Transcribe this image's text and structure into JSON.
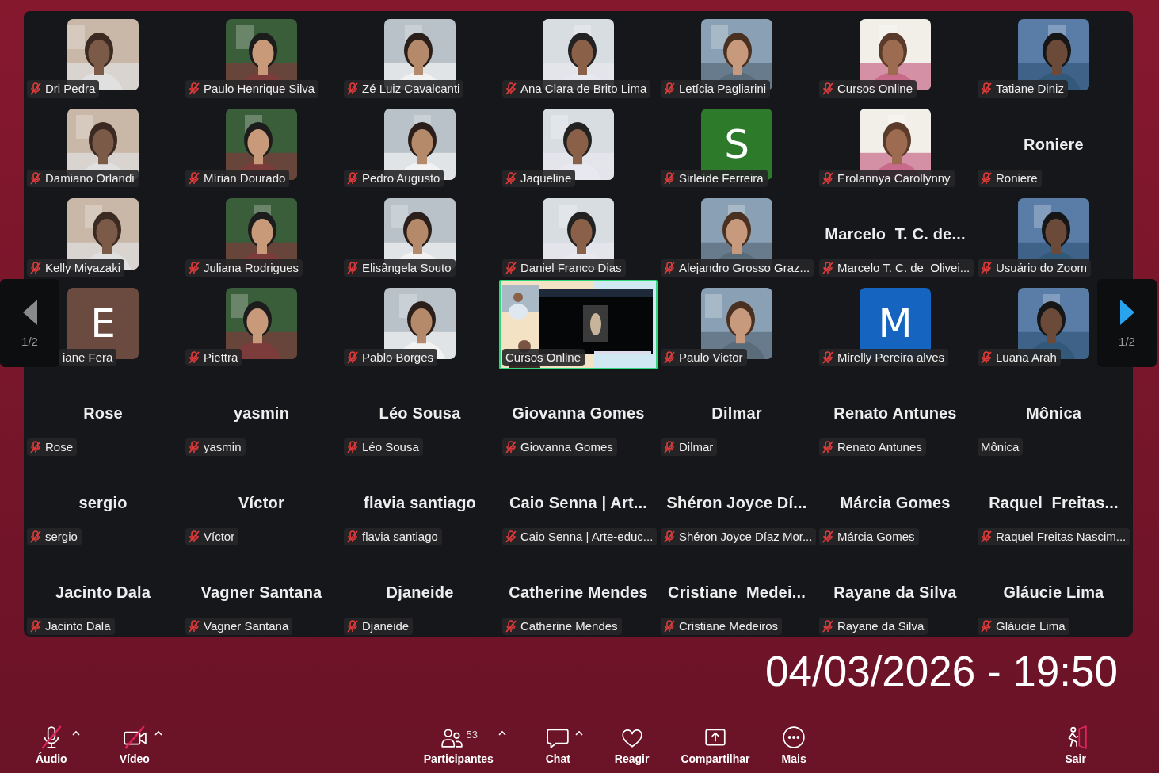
{
  "gallery": {
    "tiles": [
      {
        "label": "Dri Pedra",
        "muted": true,
        "active": false
      },
      {
        "label": "Paulo Henrique Silva",
        "muted": true,
        "active": false
      },
      {
        "label": "Zé Luiz Cavalcanti",
        "muted": true,
        "active": false
      },
      {
        "label": "Ana Clara de Brito Lima",
        "muted": true,
        "active": false
      },
      {
        "label": "Letícia Pagliarini",
        "muted": true,
        "active": false
      },
      {
        "label": "Cursos Online",
        "muted": true,
        "active": false
      },
      {
        "label": "Tatiane Diniz",
        "muted": true,
        "active": false
      },
      {
        "label": "Damiano Orlandi",
        "muted": true,
        "active": false
      },
      {
        "label": "Mírian Dourado",
        "muted": true,
        "active": false
      },
      {
        "label": "Pedro Augusto",
        "muted": true,
        "active": false
      },
      {
        "label": "Jaqueline",
        "muted": true,
        "active": false
      },
      {
        "kind": "letter",
        "letter": "S",
        "color": "#2e7a2b",
        "label": "Sirleide Ferreira",
        "muted": true,
        "active": false
      },
      {
        "label": "Erolannya Carollynny",
        "muted": true,
        "active": false
      },
      {
        "kind": "name",
        "display_name": "Roniere",
        "label": "Roniere",
        "muted": true,
        "active": false
      },
      {
        "label": "Kelly Miyazaki",
        "muted": true,
        "active": false
      },
      {
        "label": "Juliana Rodrigues",
        "muted": true,
        "active": false
      },
      {
        "label": "Elisângela Souto",
        "muted": true,
        "active": false
      },
      {
        "label": "Daniel Franco Dias",
        "muted": true,
        "active": false
      },
      {
        "label": "Alejandro Grosso Graz...",
        "muted": true,
        "active": false
      },
      {
        "kind": "name",
        "display_name": "Marcelo  T. C. de...",
        "label": "Marcelo T. C. de  Olivei...",
        "muted": true,
        "active": false
      },
      {
        "label": "Usuário do Zoom",
        "muted": true,
        "active": false
      },
      {
        "kind": "letter",
        "letter": "E",
        "color": "#6b4a40",
        "label": "iane Fera",
        "muted": false,
        "active": false,
        "partly_hidden": true
      },
      {
        "label": "Piettra",
        "muted": true,
        "active": false
      },
      {
        "label": "Pablo Borges",
        "muted": true,
        "active": false
      },
      {
        "kind": "screen",
        "label": "Cursos Online",
        "muted": false,
        "active": true
      },
      {
        "label": "Paulo Victor",
        "muted": true,
        "active": false
      },
      {
        "kind": "letter",
        "letter": "M",
        "color": "#1565c0",
        "label": "Mirelly Pereira alves",
        "muted": true,
        "active": false
      },
      {
        "label": "Luana Arah",
        "muted": true,
        "active": false
      },
      {
        "kind": "name",
        "display_name": "Rose",
        "label": "Rose",
        "muted": true,
        "active": false
      },
      {
        "kind": "name",
        "display_name": "yasmin",
        "label": "yasmin",
        "muted": true,
        "active": false
      },
      {
        "kind": "name",
        "display_name": "Léo Sousa",
        "label": "Léo Sousa",
        "muted": true,
        "active": false
      },
      {
        "kind": "name",
        "display_name": "Giovanna Gomes",
        "label": "Giovanna Gomes",
        "muted": true,
        "active": false
      },
      {
        "kind": "name",
        "display_name": "Dilmar",
        "label": "Dilmar",
        "muted": true,
        "active": false
      },
      {
        "kind": "name",
        "display_name": "Renato Antunes",
        "label": "Renato Antunes",
        "muted": true,
        "active": false
      },
      {
        "kind": "name",
        "display_name": "Mônica",
        "label": "Mônica",
        "muted": false,
        "active": false
      },
      {
        "kind": "name",
        "display_name": "sergio",
        "label": "sergio",
        "muted": true,
        "active": false
      },
      {
        "kind": "name",
        "display_name": "Víctor",
        "label": "Víctor",
        "muted": true,
        "active": false
      },
      {
        "kind": "name",
        "display_name": "flavia santiago",
        "label": "flavia santiago",
        "muted": true,
        "active": false
      },
      {
        "kind": "name",
        "display_name": "Caio Senna | Art...",
        "label": "Caio Senna | Arte-educ...",
        "muted": true,
        "active": false
      },
      {
        "kind": "name",
        "display_name": "Shéron Joyce Dí...",
        "label": "Shéron Joyce Díaz Mor...",
        "muted": true,
        "active": false
      },
      {
        "kind": "name",
        "display_name": "Márcia Gomes",
        "label": "Márcia Gomes",
        "muted": true,
        "active": false
      },
      {
        "kind": "name",
        "display_name": "Raquel  Freitas...",
        "label": "Raquel Freitas Nascim...",
        "muted": true,
        "active": false
      },
      {
        "kind": "name",
        "display_name": "Jacinto Dala",
        "label": "Jacinto Dala",
        "muted": true,
        "active": false
      },
      {
        "kind": "name",
        "display_name": "Vagner Santana",
        "label": "Vagner Santana",
        "muted": true,
        "active": false
      },
      {
        "kind": "name",
        "display_name": "Djaneide",
        "label": "Djaneide",
        "muted": true,
        "active": false
      },
      {
        "kind": "name",
        "display_name": "Catherine Mendes",
        "label": "Catherine Mendes",
        "muted": true,
        "active": false
      },
      {
        "kind": "name",
        "display_name": "Cristiane  Medei...",
        "label": "Cristiane Medeiros",
        "muted": true,
        "active": false
      },
      {
        "kind": "name",
        "display_name": "Rayane da Silva",
        "label": "Rayane da Silva",
        "muted": true,
        "active": false
      },
      {
        "kind": "name",
        "display_name": "Gláucie Lima",
        "label": "Gláucie Lima",
        "muted": true,
        "active": false
      }
    ],
    "pager": [
      {
        "kind": "prev",
        "page": "1/2",
        "disabled": true
      },
      {
        "kind": "next",
        "page": "1/2",
        "disabled": false
      }
    ]
  },
  "datetime": "04/03/2026 - 19:50",
  "toolbar": [
    {
      "kind": "audio",
      "label": "Áudio",
      "off": true,
      "has_menu": true
    },
    {
      "kind": "video",
      "label": "Vídeo",
      "off": true,
      "has_menu": true
    },
    {
      "kind": "participants",
      "label": "Participantes",
      "count": "53",
      "has_menu": true
    },
    {
      "kind": "chat",
      "label": "Chat",
      "has_menu": true
    },
    {
      "kind": "react",
      "label": "Reagir",
      "has_menu": false
    },
    {
      "kind": "share",
      "label": "Compartilhar",
      "has_menu": false
    },
    {
      "kind": "more",
      "label": "Mais",
      "has_menu": false
    },
    {
      "kind": "leave",
      "label": "Sair",
      "has_menu": false
    }
  ]
}
